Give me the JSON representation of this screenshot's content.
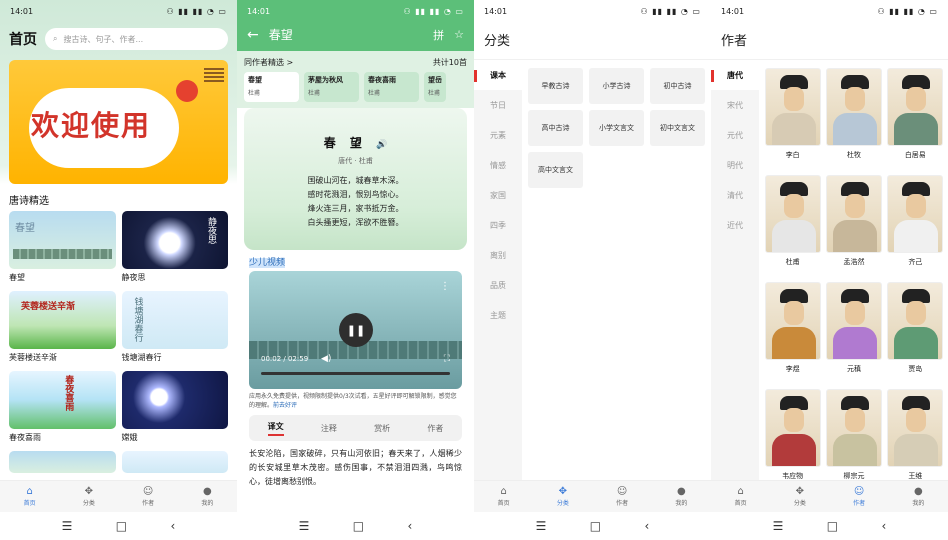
{
  "colors": {
    "accent_green": "#5cbf79",
    "tab_active": "#3b7bd8",
    "category_marker": "#e2322d"
  },
  "statusbar": {
    "time": "14:01",
    "icons": "⚇ ▮▮ ▮▮ ◔ ▭"
  },
  "navbar": {
    "menu_icon": "☰",
    "home_icon": "□",
    "back_icon": "‹"
  },
  "tabs": [
    {
      "label": "首页",
      "icon": "home-icon"
    },
    {
      "label": "分类",
      "icon": "grid-icon"
    },
    {
      "label": "作者",
      "icon": "author-icon"
    },
    {
      "label": "我的",
      "icon": "user-icon"
    }
  ],
  "home": {
    "title": "首页",
    "search_placeholder": "搜古诗、句子、作者...",
    "banner_text": "欢迎使用",
    "section_title": "唐诗精选",
    "poems": [
      {
        "name": "春望",
        "thumb_text": "春望"
      },
      {
        "name": "静夜思",
        "thumb_text": "静夜思"
      },
      {
        "name": "芙蓉楼送辛渐",
        "thumb_text": "芙蓉楼送辛渐"
      },
      {
        "name": "钱塘湖春行",
        "thumb_text": "钱塘湖春行"
      },
      {
        "name": "春夜喜雨",
        "thumb_text": "春夜喜雨"
      },
      {
        "name": "嫦娥",
        "thumb_text": ""
      }
    ]
  },
  "poem": {
    "title": "春望",
    "author_section": "同作者精选 >",
    "count": "共计10首",
    "chips": [
      {
        "name": "春望",
        "author": "杜甫"
      },
      {
        "name": "茅屋为秋风",
        "author": "杜甫"
      },
      {
        "name": "春夜喜雨",
        "author": "杜甫"
      },
      {
        "name": "望岳",
        "author": "杜甫"
      }
    ],
    "heading": "春 望",
    "meta": "唐代 · 杜甫",
    "lines": [
      "国破山河在，城春草木深。",
      "感时花溅泪，恨别鸟惊心。",
      "烽火连三月，家书抵万金。",
      "白头搔更短，浑欲不胜簪。"
    ],
    "video_label": "少儿视频",
    "video_time": "00:02 / 02:59",
    "notice": "应用永久免费提供，视频限制提供0/3次试看，五星好评即可解锁限制，感觉您的理解。",
    "notice_link": "前去好评",
    "tabs": [
      "译文",
      "注释",
      "赏析",
      "作者"
    ],
    "translation": "长安沦陷，国家破碎，只有山河依旧；春天来了，人烟稀少的长安城里草木茂密。感伤国事，不禁泪泪四溅，鸟鸣惊心，徒增离愁别恨。"
  },
  "category": {
    "title": "分类",
    "left": [
      "课本",
      "节日",
      "元素",
      "情感",
      "家国",
      "四季",
      "离别",
      "品质",
      "主题"
    ],
    "items": [
      "早教古诗",
      "小学古诗",
      "初中古诗",
      "高中古诗",
      "小学文言文",
      "初中文言文",
      "高中文言文"
    ]
  },
  "authors": {
    "title": "作者",
    "left": [
      "唐代",
      "宋代",
      "元代",
      "明代",
      "清代",
      "近代"
    ],
    "items": [
      {
        "name": "李白",
        "robe": "#d7cbb4"
      },
      {
        "name": "杜牧",
        "robe": "#b7c7d6"
      },
      {
        "name": "白居易",
        "robe": "#6b8f7a"
      },
      {
        "name": "杜甫",
        "robe": "#e6e6e6"
      },
      {
        "name": "孟浩然",
        "robe": "#c7b79a"
      },
      {
        "name": "齐己",
        "robe": "#f0f0f0"
      },
      {
        "name": "李煜",
        "robe": "#c98a3a"
      },
      {
        "name": "元稹",
        "robe": "#b07ad0"
      },
      {
        "name": "贾岛",
        "robe": "#5e9b74"
      },
      {
        "name": "韦应物",
        "robe": "#b23b3b"
      },
      {
        "name": "柳宗元",
        "robe": "#c8c2a0"
      },
      {
        "name": "王维",
        "robe": "#d6cdb6"
      }
    ]
  }
}
